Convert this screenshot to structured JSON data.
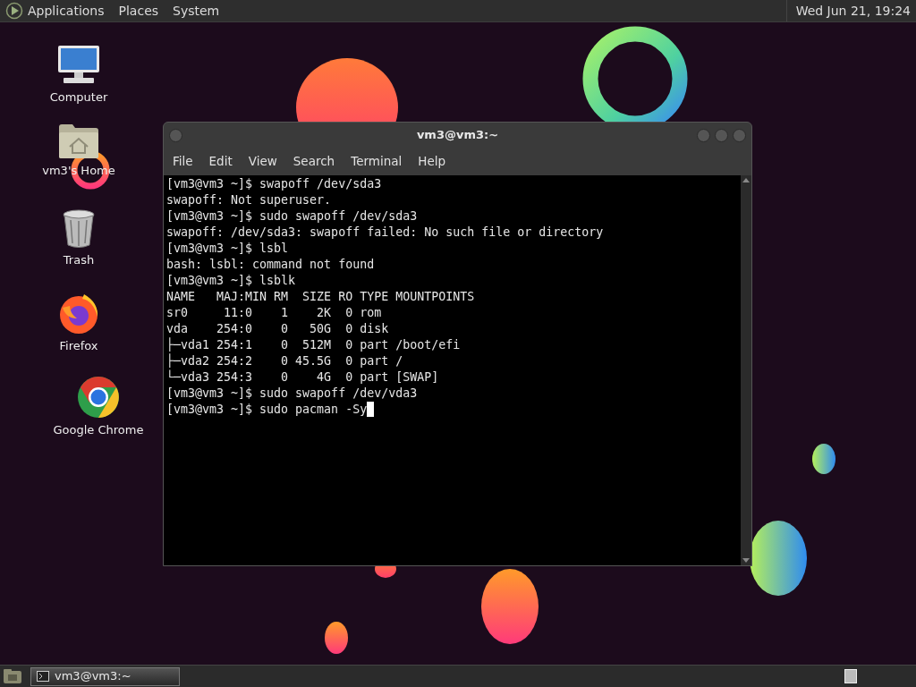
{
  "top_panel": {
    "menus": [
      "Applications",
      "Places",
      "System"
    ],
    "clock": "Wed Jun 21, 19:24"
  },
  "desktop_icons": [
    {
      "kind": "computer",
      "label": "Computer"
    },
    {
      "kind": "home",
      "label": "vm3's Home"
    },
    {
      "kind": "trash",
      "label": "Trash"
    },
    {
      "kind": "firefox",
      "label": "Firefox"
    },
    {
      "kind": "chrome",
      "label": "Google Chrome"
    }
  ],
  "terminal_window": {
    "title": "vm3@vm3:~",
    "menu": [
      "File",
      "Edit",
      "View",
      "Search",
      "Terminal",
      "Help"
    ],
    "lines": [
      "[vm3@vm3 ~]$ swapoff /dev/sda3",
      "swapoff: Not superuser.",
      "[vm3@vm3 ~]$ sudo swapoff /dev/sda3",
      "swapoff: /dev/sda3: swapoff failed: No such file or directory",
      "[vm3@vm3 ~]$ lsbl",
      "bash: lsbl: command not found",
      "[vm3@vm3 ~]$ lsblk",
      "NAME   MAJ:MIN RM  SIZE RO TYPE MOUNTPOINTS",
      "sr0     11:0    1    2K  0 rom",
      "vda    254:0    0   50G  0 disk",
      "├─vda1 254:1    0  512M  0 part /boot/efi",
      "├─vda2 254:2    0 45.5G  0 part /",
      "└─vda3 254:3    0    4G  0 part [SWAP]",
      "[vm3@vm3 ~]$ sudo swapoff /dev/vda3",
      "[vm3@vm3 ~]$ sudo pacman -Sy"
    ],
    "cursor": true
  },
  "taskbar": {
    "tasks": [
      {
        "label": "vm3@vm3:~",
        "selected": true
      }
    ]
  }
}
